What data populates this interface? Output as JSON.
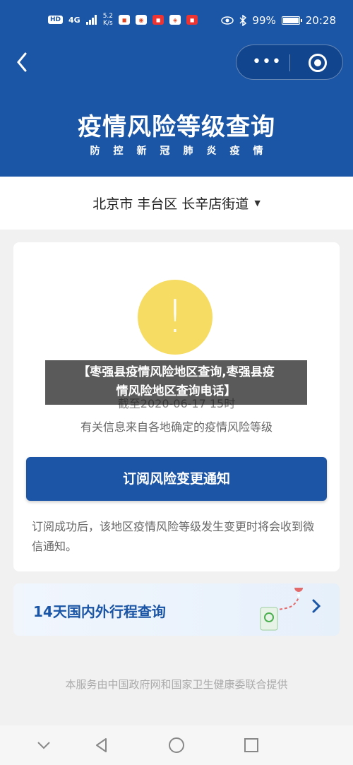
{
  "status_bar": {
    "network_badge": "HD",
    "signal": "4G",
    "speed_value": "5.2",
    "speed_unit": "K/s",
    "battery": "99%",
    "time": "20:28"
  },
  "header": {
    "title": "疫情风险等级查询",
    "subtitle": "防控新冠肺炎疫情"
  },
  "location": {
    "text": "北京市 丰台区 长辛店街道"
  },
  "risk_card": {
    "deadline": "截至2020-06-17 15时",
    "info": "有关信息来自各地确定的疫情风险等级",
    "subscribe_button": "订阅风险变更通知",
    "subscribe_note": "订阅成功后，该地区疫情风险等级发生变更时将会收到微信通知。"
  },
  "trip_card": {
    "label": "14天国内外行程查询"
  },
  "footer": {
    "text": "本服务由中国政府网和国家卫生健康委联合提供"
  },
  "overlay": {
    "line1": "【枣强县疫情风险地区查询,枣强县疫",
    "line2": "情风险地区查询电话】"
  },
  "colors": {
    "brand_blue": "#1b55a5",
    "warning_yellow": "#f6dc62",
    "background": "#f1f1f1"
  }
}
